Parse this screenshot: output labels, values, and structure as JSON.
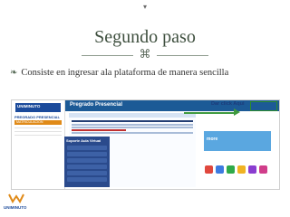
{
  "slide": {
    "title": "Segundo paso",
    "title_icon": "⌘",
    "bullet_icon": "❧",
    "bullet_text": "Consiste en ingresar ala plataforma de manera sencilla",
    "footer_text": "UNIMINUTO"
  },
  "screenshot": {
    "left_panel": {
      "logo_text": "UNIMINUTO",
      "section_title": "PREGRADO PRESENCIAL",
      "highlighted_item": "MATRICULACION",
      "side_box_title": "Soporte Aula Virtual"
    },
    "top_bar": {
      "title": "Pregrado Presencial",
      "dar_click": "Dar click Aqui"
    },
    "right_panel": {
      "banner_text": "more"
    }
  },
  "colors": {
    "title_color": "#3e4f3e",
    "brand_blue": "#1c5a96",
    "highlight_orange": "#e08a18",
    "arrow_green": "#3f9a3f"
  }
}
